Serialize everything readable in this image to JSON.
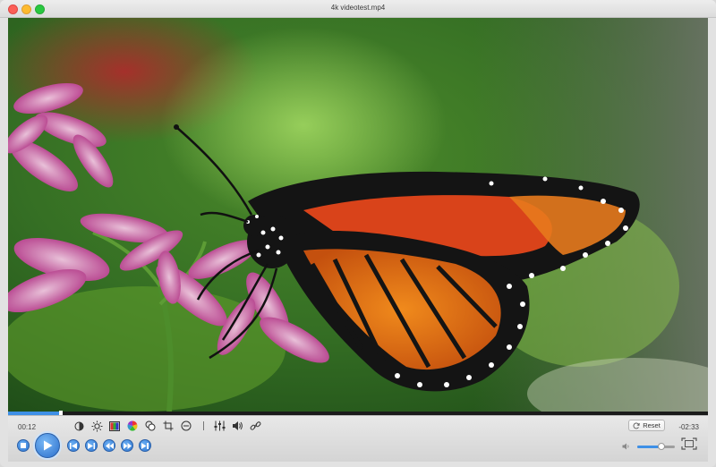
{
  "window": {
    "title": "4k videotest.mp4"
  },
  "playback": {
    "elapsed": "00:12",
    "remaining": "-02:33",
    "progress_fraction": 0.075,
    "volume_fraction": 0.65
  },
  "toolbar": {
    "reset_label": "Reset",
    "tools": [
      "contrast-icon",
      "brightness-icon",
      "color-bars-icon",
      "color-wheel-icon",
      "overlay-icon",
      "crop-icon",
      "minus-circle-icon",
      "equalizer-icon",
      "audio-icon",
      "link-icon"
    ]
  },
  "transport": {
    "buttons": [
      "stop-icon",
      "play-icon",
      "skip-back-icon",
      "skip-forward-icon",
      "rewind-icon",
      "fast-forward-icon",
      "frame-forward-icon"
    ]
  },
  "colors": {
    "accent": "#3e90e6",
    "background": "#e2e2e2"
  }
}
